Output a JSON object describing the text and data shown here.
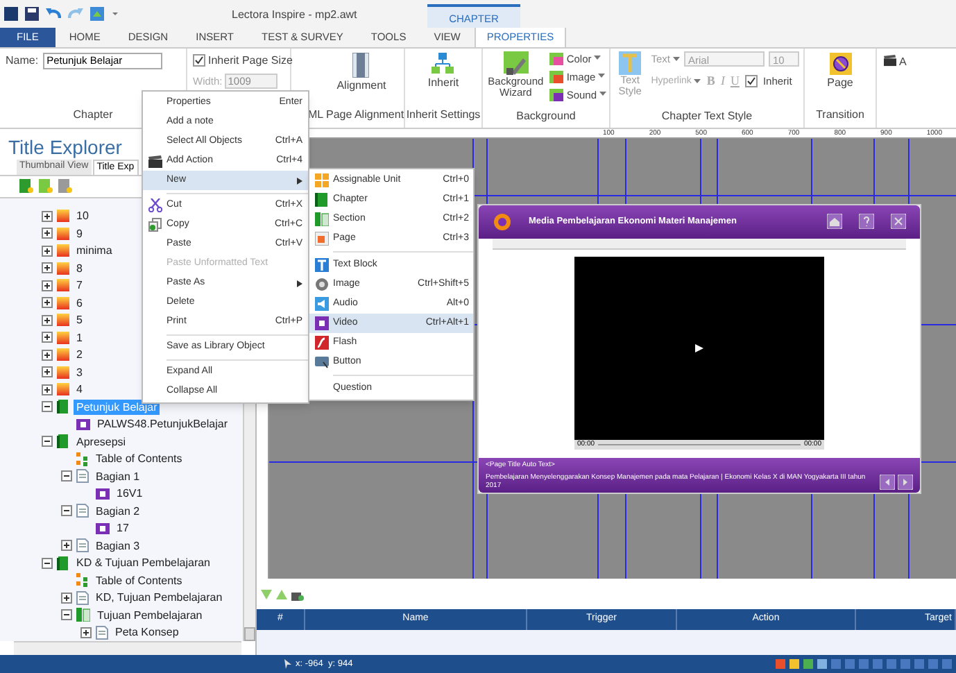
{
  "window": {
    "title": "Lectora Inspire - mp2.awt",
    "context_tab": "CHAPTER"
  },
  "ribbon_tabs": [
    {
      "label": "FILE",
      "selected": false,
      "kind": "file"
    },
    {
      "label": "HOME",
      "selected": false,
      "kind": "tab"
    },
    {
      "label": "DESIGN",
      "selected": false,
      "kind": "tab"
    },
    {
      "label": "INSERT",
      "selected": false,
      "kind": "tab"
    },
    {
      "label": "TEST & SURVEY",
      "selected": false,
      "kind": "tab"
    },
    {
      "label": "TOOLS",
      "selected": false,
      "kind": "tab"
    },
    {
      "label": "VIEW",
      "selected": false,
      "kind": "tab"
    },
    {
      "label": "PROPERTIES",
      "selected": true,
      "kind": "tab"
    }
  ],
  "ribbon": {
    "name_label": "Name:",
    "name_value": "Petunjuk Belajar",
    "chapter_group": "Chapter",
    "inherit_page_size": {
      "label": "Inherit Page Size",
      "checked": true
    },
    "width_label": "Width:",
    "width_value": "1009",
    "alignment_button": "Alignment",
    "alignment_group": "ML Page Alignment",
    "inherit_button": "Inherit",
    "inherit_group": "Inherit Settings",
    "background_wizard": "Background Wizard",
    "bg_color": "Color",
    "bg_image": "Image",
    "bg_sound": "Sound",
    "background_group": "Background",
    "text_style": "Text Style",
    "text_button": "Text",
    "font": "Arial",
    "size": "10",
    "hyperlink": "Hyperlink",
    "bold": "B",
    "italic": "I",
    "underline": "U",
    "inherit_text": {
      "label": "Inherit",
      "checked": true
    },
    "text_style_group": "Chapter Text Style",
    "page_button": "Page",
    "transition_group": "Transition",
    "cut_button": "A"
  },
  "ruler": [
    "100",
    "200",
    "500",
    "600",
    "700",
    "800",
    "900",
    "1000"
  ],
  "title_explorer": {
    "heading": "Title Explorer",
    "tabs": [
      {
        "label": "Thumbnail View",
        "selected": false
      },
      {
        "label": "Title Exp",
        "selected": true
      }
    ]
  },
  "tree": [
    {
      "label": "10",
      "kind": "page",
      "selected": false,
      "expanded": false
    },
    {
      "label": "9",
      "kind": "page",
      "selected": false,
      "expanded": false
    },
    {
      "label": "minima",
      "kind": "page",
      "selected": false,
      "expanded": false
    },
    {
      "label": "8",
      "kind": "page",
      "selected": false,
      "expanded": false
    },
    {
      "label": "7",
      "kind": "page",
      "selected": false,
      "expanded": false
    },
    {
      "label": "6",
      "kind": "page",
      "selected": false,
      "expanded": false
    },
    {
      "label": "5",
      "kind": "page",
      "selected": false,
      "expanded": false
    },
    {
      "label": "1",
      "kind": "page",
      "selected": false,
      "expanded": false
    },
    {
      "label": "2",
      "kind": "page",
      "selected": false,
      "expanded": false
    },
    {
      "label": "3",
      "kind": "page",
      "selected": false,
      "expanded": false
    },
    {
      "label": "4",
      "kind": "page",
      "selected": false,
      "expanded": false
    },
    {
      "label": "Petunjuk Belajar",
      "kind": "chapter",
      "selected": true,
      "expanded": true,
      "children": [
        {
          "label": "PALWS48.PetunjukBelajar",
          "kind": "video",
          "selected": false
        }
      ]
    },
    {
      "label": "Apresepsi",
      "kind": "chapter",
      "selected": false,
      "expanded": true,
      "children": [
        {
          "label": "Table of Contents",
          "kind": "toc",
          "selected": false
        },
        {
          "label": "Bagian 1",
          "kind": "doc",
          "selected": false,
          "expanded": true,
          "children": [
            {
              "label": "16V1",
              "kind": "video",
              "selected": false
            }
          ]
        },
        {
          "label": "Bagian 2",
          "kind": "doc",
          "selected": false,
          "expanded": true,
          "children": [
            {
              "label": "17",
              "kind": "video",
              "selected": false
            }
          ]
        },
        {
          "label": "Bagian 3",
          "kind": "doc",
          "selected": false,
          "expanded": false
        }
      ]
    },
    {
      "label": "KD & Tujuan Pembelajaran",
      "kind": "chapter",
      "selected": false,
      "expanded": true,
      "children": [
        {
          "label": "Table of Contents",
          "kind": "toc",
          "selected": false
        },
        {
          "label": "KD, Tujuan Pembelajaran",
          "kind": "doc",
          "selected": false,
          "expanded": false
        },
        {
          "label": "Tujuan Pembelajaran",
          "kind": "section",
          "selected": false,
          "expanded": true,
          "children": [
            {
              "label": "Peta Konsep",
              "kind": "doc",
              "selected": false,
              "expanded": false
            }
          ]
        }
      ]
    }
  ],
  "context_menu": [
    {
      "label": "Properties",
      "shortcut": "Enter",
      "disabled": false,
      "selected": false,
      "submenu": false,
      "separator_before": false
    },
    {
      "label": "Add a note",
      "disabled": false,
      "selected": false,
      "submenu": false,
      "separator_before": false
    },
    {
      "label": "Select All Objects",
      "shortcut": "Ctrl+A",
      "disabled": false,
      "selected": false,
      "submenu": false,
      "separator_before": false
    },
    {
      "label": "Add Action",
      "shortcut": "Ctrl+4",
      "disabled": false,
      "selected": false,
      "submenu": false,
      "separator_before": false
    },
    {
      "label": "New",
      "disabled": false,
      "selected": true,
      "submenu": true,
      "separator_before": false
    },
    {
      "label": "Cut",
      "shortcut": "Ctrl+X",
      "disabled": false,
      "selected": false,
      "submenu": false,
      "separator_before": true
    },
    {
      "label": "Copy",
      "shortcut": "Ctrl+C",
      "disabled": false,
      "selected": false,
      "submenu": false,
      "separator_before": false
    },
    {
      "label": "Paste",
      "shortcut": "Ctrl+V",
      "disabled": false,
      "selected": false,
      "submenu": false,
      "separator_before": false
    },
    {
      "label": "Paste Unformatted Text",
      "disabled": true,
      "selected": false,
      "submenu": false,
      "separator_before": false
    },
    {
      "label": "Paste As",
      "disabled": false,
      "selected": false,
      "submenu": true,
      "separator_before": false
    },
    {
      "label": "Delete",
      "disabled": false,
      "selected": false,
      "submenu": false,
      "separator_before": false
    },
    {
      "label": "Print",
      "shortcut": "Ctrl+P",
      "disabled": false,
      "selected": false,
      "submenu": false,
      "separator_before": false
    },
    {
      "label": "Save as Library Object",
      "disabled": false,
      "selected": false,
      "submenu": false,
      "separator_before": true
    },
    {
      "label": "Expand All",
      "disabled": false,
      "selected": false,
      "submenu": false,
      "separator_before": true
    },
    {
      "label": "Collapse All",
      "disabled": false,
      "selected": false,
      "submenu": false,
      "separator_before": false
    }
  ],
  "submenu": [
    {
      "label": "Assignable Unit",
      "shortcut": "Ctrl+0",
      "selected": false,
      "separator_before": false
    },
    {
      "label": "Chapter",
      "shortcut": "Ctrl+1",
      "selected": false,
      "separator_before": false
    },
    {
      "label": "Section",
      "shortcut": "Ctrl+2",
      "selected": false,
      "separator_before": false
    },
    {
      "label": "Page",
      "shortcut": "Ctrl+3",
      "selected": false,
      "separator_before": false
    },
    {
      "label": "Text Block",
      "selected": false,
      "separator_before": true
    },
    {
      "label": "Image",
      "shortcut": "Ctrl+Shift+5",
      "selected": false,
      "separator_before": false
    },
    {
      "label": "Audio",
      "shortcut": "Alt+0",
      "selected": false,
      "separator_before": false
    },
    {
      "label": "Video",
      "shortcut": "Ctrl+Alt+1",
      "selected": true,
      "separator_before": false
    },
    {
      "label": "Flash",
      "selected": false,
      "separator_before": false
    },
    {
      "label": "Button",
      "selected": false,
      "separator_before": false
    },
    {
      "label": "Question",
      "selected": false,
      "separator_before": true
    }
  ],
  "slide": {
    "title": "Media Pembelajaran Ekonomi Materi Manajemen",
    "page_title": "<Page Title Auto Text>",
    "footer": "Pembelajaran Menyelenggarakan Konsep Manajemen pada mata Pelajaran | Ekonomi Kelas X di MAN Yogyakarta III tahun 2017",
    "time_start": "00:00",
    "time_end": "00:00"
  },
  "actions": {
    "columns": [
      "#",
      "Name",
      "Trigger",
      "Action",
      "Target"
    ]
  },
  "status_bar": {
    "coords": "x: -964  y: 944"
  }
}
